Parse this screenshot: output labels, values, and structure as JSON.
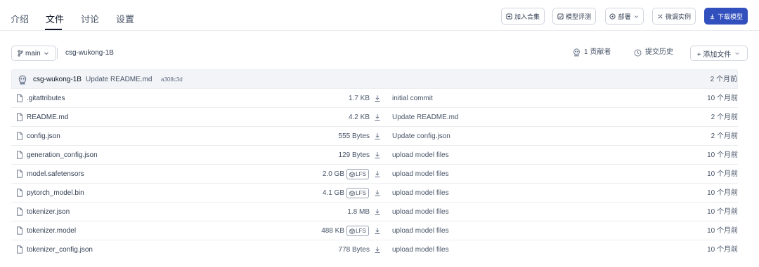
{
  "tabs": [
    {
      "label": "介绍"
    },
    {
      "label": "文件"
    },
    {
      "label": "讨论"
    },
    {
      "label": "设置"
    }
  ],
  "actions": {
    "add_collection": "加入合集",
    "model_eval": "模型评测",
    "deploy": "部署",
    "finetune": "微调实例",
    "download": "下载模型"
  },
  "branch": {
    "name": "main"
  },
  "path": "csg-wukong-1B",
  "meta": {
    "contributors": "1 贡献者",
    "history": "提交历史",
    "add_file": "+ 添加文件"
  },
  "last_commit": {
    "author": "csg-wukong-1B",
    "message": "Update README.md",
    "hash": "a308c3d",
    "time": "2 个月前"
  },
  "lfs_label": "LFS",
  "files": [
    {
      "name": ".gitattributes",
      "size": "1.7 KB",
      "lfs": false,
      "message": "initial commit",
      "time": "10 个月前"
    },
    {
      "name": "README.md",
      "size": "4.2 KB",
      "lfs": false,
      "message": "Update README.md",
      "time": "2 个月前"
    },
    {
      "name": "config.json",
      "size": "555 Bytes",
      "lfs": false,
      "message": "Update config.json",
      "time": "2 个月前"
    },
    {
      "name": "generation_config.json",
      "size": "129 Bytes",
      "lfs": false,
      "message": "upload model files",
      "time": "10 个月前"
    },
    {
      "name": "model.safetensors",
      "size": "2.0 GB",
      "lfs": true,
      "message": "upload model files",
      "time": "10 个月前"
    },
    {
      "name": "pytorch_model.bin",
      "size": "4.1 GB",
      "lfs": true,
      "message": "upload model files",
      "time": "10 个月前"
    },
    {
      "name": "tokenizer.json",
      "size": "1.8 MB",
      "lfs": false,
      "message": "upload model files",
      "time": "10 个月前"
    },
    {
      "name": "tokenizer.model",
      "size": "488 KB",
      "lfs": true,
      "message": "upload model files",
      "time": "10 个月前"
    },
    {
      "name": "tokenizer_config.json",
      "size": "778 Bytes",
      "lfs": false,
      "message": "upload model files",
      "time": "10 个月前"
    }
  ],
  "colors": {
    "primary": "#3250bd",
    "border": "#eaecf0",
    "header_row": "#f2f4f7",
    "text": "#344054"
  }
}
